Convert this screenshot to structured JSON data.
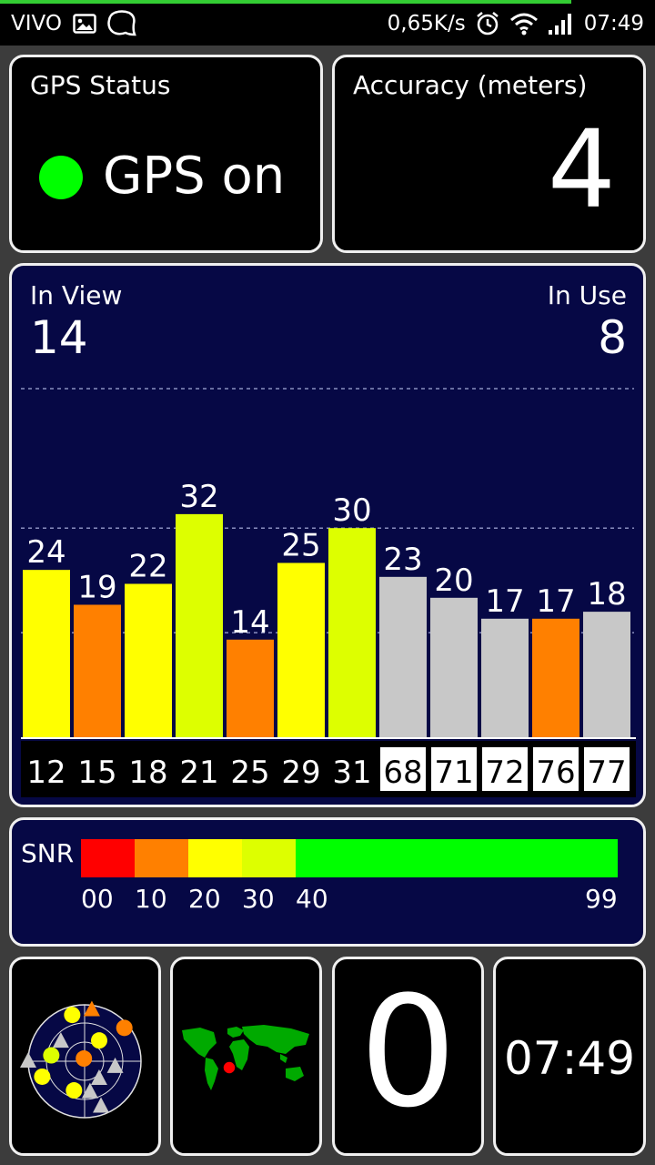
{
  "status_bar": {
    "carrier": "VIVO",
    "speed": "0,65K/s",
    "time": "07:49",
    "icons": [
      "gallery-icon",
      "chat-bubble-icon",
      "alarm-icon",
      "wifi-icon",
      "signal-icon"
    ]
  },
  "gps_status": {
    "title": "GPS Status",
    "state": "GPS on",
    "indicator_color": "#00ff00"
  },
  "accuracy": {
    "title": "Accuracy (meters)",
    "value": "4"
  },
  "satellites": {
    "in_view_label": "In View",
    "in_view": "14",
    "in_use_label": "In Use",
    "in_use": "8"
  },
  "chart_data": {
    "type": "bar",
    "categories": [
      "12",
      "15",
      "18",
      "21",
      "25",
      "29",
      "31",
      "68",
      "71",
      "72",
      "76",
      "77"
    ],
    "values": [
      24,
      19,
      22,
      32,
      14,
      25,
      30,
      23,
      20,
      17,
      17,
      18
    ],
    "colors": [
      "#ffff00",
      "#ff8000",
      "#ffff00",
      "#ddff00",
      "#ff8000",
      "#ffff00",
      "#ddff00",
      "#c8c8c8",
      "#c8c8c8",
      "#c8c8c8",
      "#ff8000",
      "#c8c8c8"
    ],
    "in_use": [
      true,
      true,
      true,
      true,
      true,
      true,
      true,
      false,
      false,
      false,
      false,
      false
    ],
    "ylim": [
      0,
      50
    ],
    "grid": true
  },
  "snr": {
    "label": "SNR",
    "segments": [
      {
        "from": 0,
        "to": 10,
        "color": "#ff0000"
      },
      {
        "from": 10,
        "to": 20,
        "color": "#ff8000"
      },
      {
        "from": 20,
        "to": 30,
        "color": "#ffff00"
      },
      {
        "from": 30,
        "to": 40,
        "color": "#ddff00"
      },
      {
        "from": 40,
        "to": 99,
        "color": "#00ff00"
      }
    ],
    "ticks": [
      "00",
      "10",
      "20",
      "30",
      "40",
      "99"
    ]
  },
  "widgets": {
    "speed": "0",
    "clock": "07:49",
    "map_marker_color": "#ff0000",
    "map_land_color": "#00aa00"
  },
  "radar": {
    "satellites": [
      {
        "shape": "circle",
        "color": "#ffff00",
        "az": 345,
        "r": 0.85
      },
      {
        "shape": "triangle",
        "color": "#ff8000",
        "az": 8,
        "r": 0.92
      },
      {
        "shape": "circle",
        "color": "#ff8000",
        "az": 50,
        "r": 0.92
      },
      {
        "shape": "circle",
        "color": "#ffff00",
        "az": 35,
        "r": 0.45
      },
      {
        "shape": "triangle",
        "color": "#c8c8c8",
        "az": 310,
        "r": 0.55
      },
      {
        "shape": "circle",
        "color": "#ddff00",
        "az": 280,
        "r": 0.6
      },
      {
        "shape": "circle",
        "color": "#ff8000",
        "az": 345,
        "r": 0.05
      },
      {
        "shape": "triangle",
        "color": "#c8c8c8",
        "az": 270,
        "r": 1.0
      },
      {
        "shape": "circle",
        "color": "#ffff00",
        "az": 250,
        "r": 0.8
      },
      {
        "shape": "triangle",
        "color": "#c8c8c8",
        "az": 100,
        "r": 0.55
      },
      {
        "shape": "triangle",
        "color": "#c8c8c8",
        "az": 140,
        "r": 0.4
      },
      {
        "shape": "circle",
        "color": "#ffff00",
        "az": 200,
        "r": 0.55
      },
      {
        "shape": "triangle",
        "color": "#c8c8c8",
        "az": 170,
        "r": 0.55
      },
      {
        "shape": "triangle",
        "color": "#c8c8c8",
        "az": 160,
        "r": 0.85
      }
    ]
  }
}
